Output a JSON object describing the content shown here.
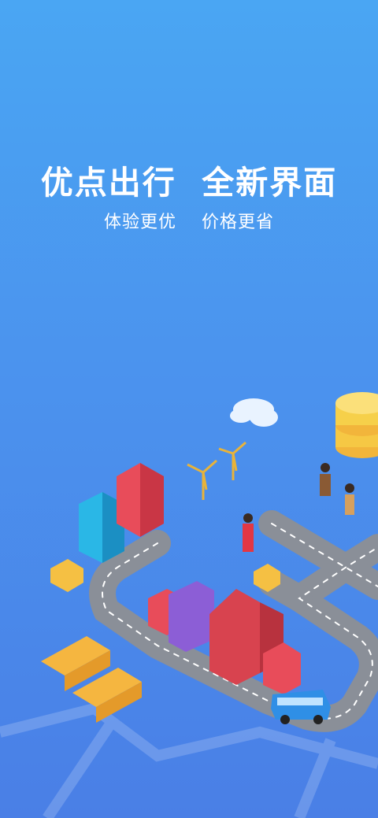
{
  "splash": {
    "headline": "优点出行  全新界面",
    "subline": "体验更优    价格更省"
  },
  "colors": {
    "background_top": "#4aa6f3",
    "background_bottom": "#4a7fe6",
    "road": "#8a8f98",
    "coin": "#f6d04a",
    "bus": "#2a73d9"
  }
}
